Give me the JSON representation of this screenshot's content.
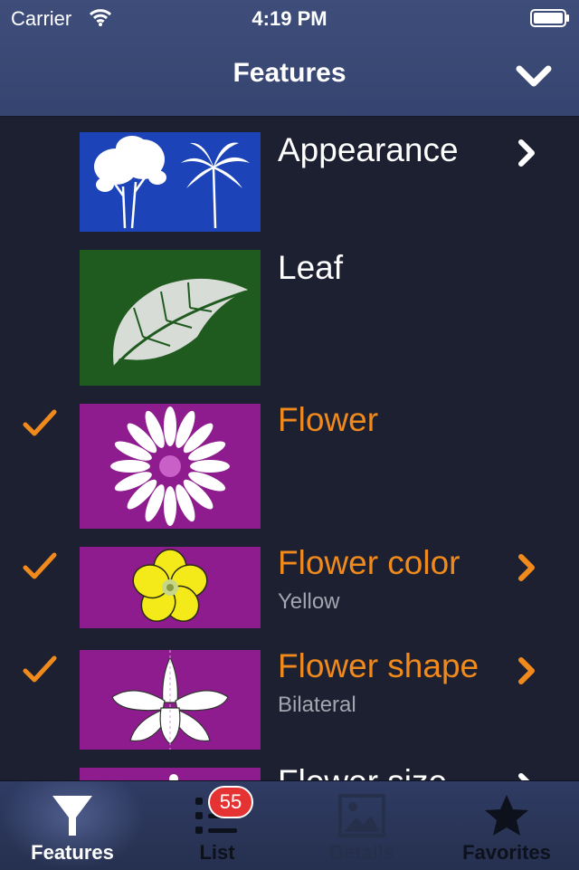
{
  "status_bar": {
    "carrier": "Carrier",
    "time": "4:19 PM"
  },
  "nav": {
    "title": "Features",
    "collapse_icon": "chevron-down-icon"
  },
  "features": [
    {
      "title": "Appearance",
      "subtitle": "",
      "checked": false,
      "has_disclosure": true,
      "thumb_color": "#1c44b8",
      "icon": "tree-silhouette-icon"
    },
    {
      "title": "Leaf",
      "subtitle": "",
      "checked": false,
      "has_disclosure": false,
      "thumb_color": "#1f5a1f",
      "icon": "leaf-icon"
    },
    {
      "title": "Flower",
      "subtitle": "",
      "checked": true,
      "has_disclosure": false,
      "thumb_color": "#8e1c8e",
      "icon": "daisy-flower-icon"
    },
    {
      "title": "Flower color",
      "subtitle": "Yellow",
      "checked": true,
      "has_disclosure": true,
      "thumb_color": "#8e1c8e",
      "icon": "yellow-flower-icon"
    },
    {
      "title": "Flower shape",
      "subtitle": "Bilateral",
      "checked": true,
      "has_disclosure": true,
      "thumb_color": "#8e1c8e",
      "icon": "orchid-flower-icon"
    },
    {
      "title": "Flower size",
      "subtitle": "",
      "checked": false,
      "has_disclosure": true,
      "thumb_color": "#8e1c8e",
      "icon": "flower-size-icon"
    }
  ],
  "tabs": [
    {
      "label": "Features",
      "icon": "funnel-icon",
      "state": "selected"
    },
    {
      "label": "List",
      "icon": "list-icon",
      "state": "normal",
      "badge": "55"
    },
    {
      "label": "Details",
      "icon": "image-icon",
      "state": "disabled"
    },
    {
      "label": "Favorites",
      "icon": "star-icon",
      "state": "normal"
    }
  ],
  "colors": {
    "accent": "#f08a1c",
    "nav_bar": "#3a4874",
    "background": "#1c2030",
    "badge": "#e53333"
  }
}
